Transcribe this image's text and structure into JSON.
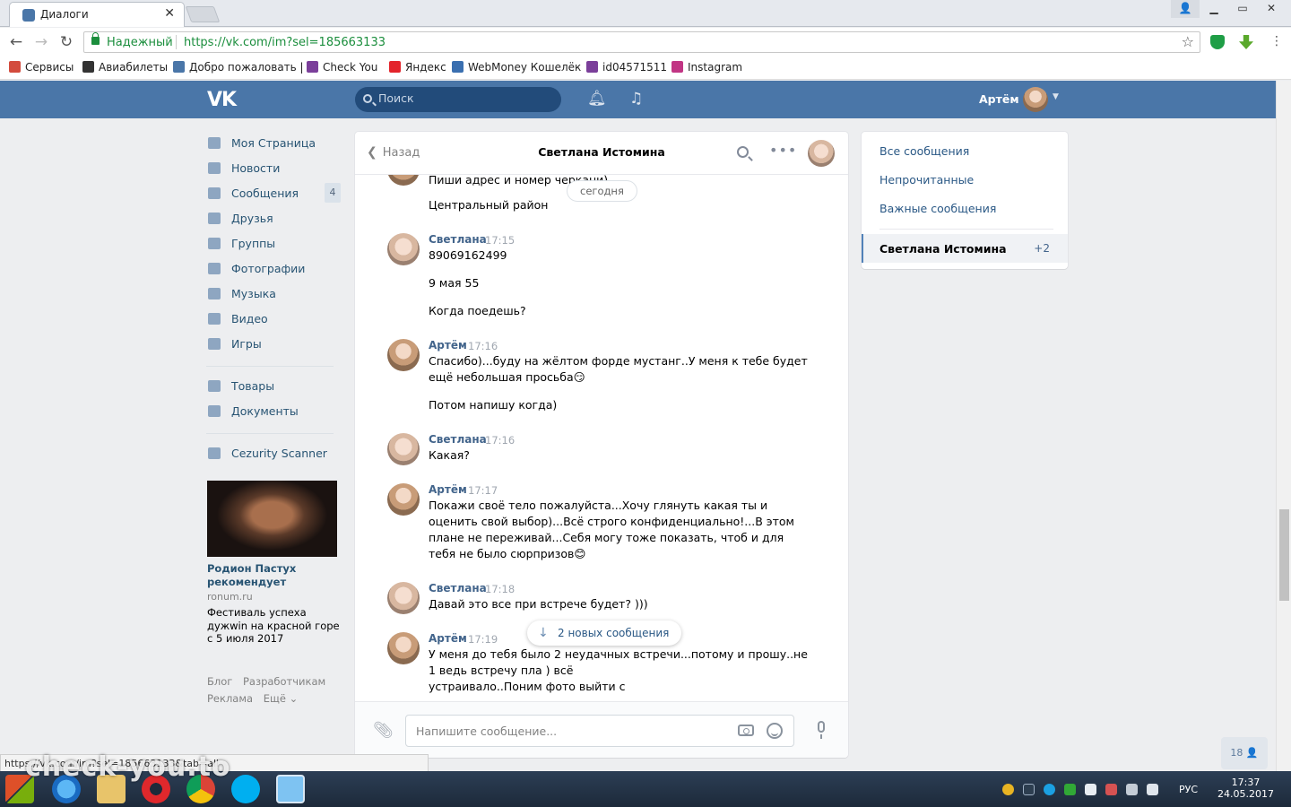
{
  "browser": {
    "tab_title": "Диалоги",
    "tab_close": "✕",
    "secure_label": "Надежный",
    "url": "https://vk.com/im?sel=185663133",
    "window_controls": [
      "▁",
      "▭",
      "✕"
    ],
    "bookmarks": [
      {
        "label": "Сервисы",
        "icon": "apps-icon",
        "color": "#d34b3d"
      },
      {
        "label": "Авиабилеты",
        "icon": "plane-icon",
        "color": "#333333"
      },
      {
        "label": "Добро пожаловать |",
        "icon": "vk-icon",
        "color": "#4a76a8"
      },
      {
        "label": "Check You",
        "icon": "check-you-icon",
        "color": "#7b3f9a"
      },
      {
        "label": "Яндекс",
        "icon": "yandex-icon",
        "color": "#e3242b"
      },
      {
        "label": "WebMoney Кошелёк",
        "icon": "globe-icon",
        "color": "#3a6fb0"
      },
      {
        "label": "id04571511",
        "icon": "s-icon",
        "color": "#7b3f9a"
      },
      {
        "label": "Instagram",
        "icon": "instagram-icon",
        "color": "#c13584"
      }
    ]
  },
  "vk_header": {
    "logo": "VK",
    "search_placeholder": "Поиск",
    "user_name": "Артём",
    "accent": "#4a76a8"
  },
  "left_nav": {
    "items": [
      {
        "label": "Моя Страница",
        "icon": "home-icon"
      },
      {
        "label": "Новости",
        "icon": "news-icon"
      },
      {
        "label": "Сообщения",
        "icon": "messages-icon",
        "count": "4"
      },
      {
        "label": "Друзья",
        "icon": "friends-icon"
      },
      {
        "label": "Группы",
        "icon": "groups-icon"
      },
      {
        "label": "Фотографии",
        "icon": "camera-icon"
      },
      {
        "label": "Музыка",
        "icon": "music-icon"
      },
      {
        "label": "Видео",
        "icon": "video-icon"
      },
      {
        "label": "Игры",
        "icon": "gamepad-icon"
      }
    ],
    "items2": [
      {
        "label": "Товары",
        "icon": "bag-icon"
      },
      {
        "label": "Документы",
        "icon": "document-icon"
      }
    ],
    "items3": [
      {
        "label": "Cezurity Scanner",
        "icon": "apps-grid-icon"
      }
    ],
    "ad": {
      "title": "Родион Пастух рекомендует",
      "site": "ronum.ru",
      "text": "Фестиваль успеха дужwin на красной горе с 5 июля 2017"
    },
    "footer": [
      "Блог",
      "Разработчикам",
      "Реклама",
      "Ещё ⌄"
    ]
  },
  "chat": {
    "back_label": "Назад",
    "title": "Светлана Истомина",
    "day_badge": "сегодня",
    "top_lines": [
      "Пиши адрес и номер черкани)",
      "Центральный район"
    ],
    "messages": [
      {
        "author": "Светлана",
        "time": "17:15",
        "lines": [
          "89069162499",
          "",
          "9 мая 55",
          "",
          "Когда поедешь?"
        ]
      },
      {
        "author": "Артём",
        "time": "17:16",
        "lines": [
          "Спасибо)...буду на жёлтом форде мустанг..У меня к тебе будет",
          "ещё небольшая просьба😏",
          "",
          "Потом напишу когда)"
        ]
      },
      {
        "author": "Светлана",
        "time": "17:16",
        "lines": [
          "Какая?"
        ]
      },
      {
        "author": "Артём",
        "time": "17:17",
        "lines": [
          "Покажи своё тело пожалуйста...Хочу глянуть какая ты и",
          "оценить свой выбор)...Всё строго конфиденциально!...В этом",
          "плане не переживай...Себя могу тоже показать, чтоб и для",
          "тебя не было сюрпризов😊"
        ]
      },
      {
        "author": "Светлана",
        "time": "17:18",
        "lines": [
          "Давай это все при встрече будет? )))"
        ]
      },
      {
        "author": "Артём",
        "time": "17:19",
        "lines": [
          "У меня до тебя было 2 неудачных встречи...потому и прошу..не",
          "1 ведь встречу пла                              ) всё",
          "устраивало..Поним                               фото выйти с"
        ]
      }
    ],
    "new_messages": "2 новых сообщения",
    "composer_placeholder": "Напишите сообщение..."
  },
  "right_menu": {
    "items": [
      "Все сообщения",
      "Непрочитанные",
      "Важные сообщения"
    ],
    "active": {
      "name": "Светлана Истомина",
      "count": "+2"
    }
  },
  "friends_online": "18 👤",
  "status_url": "https://vk.com/im?sel=185663133&tab=all",
  "watermark": "check-you.to",
  "taskbar": {
    "lang": "РУС",
    "time": "17:37",
    "date": "24.05.2017"
  }
}
